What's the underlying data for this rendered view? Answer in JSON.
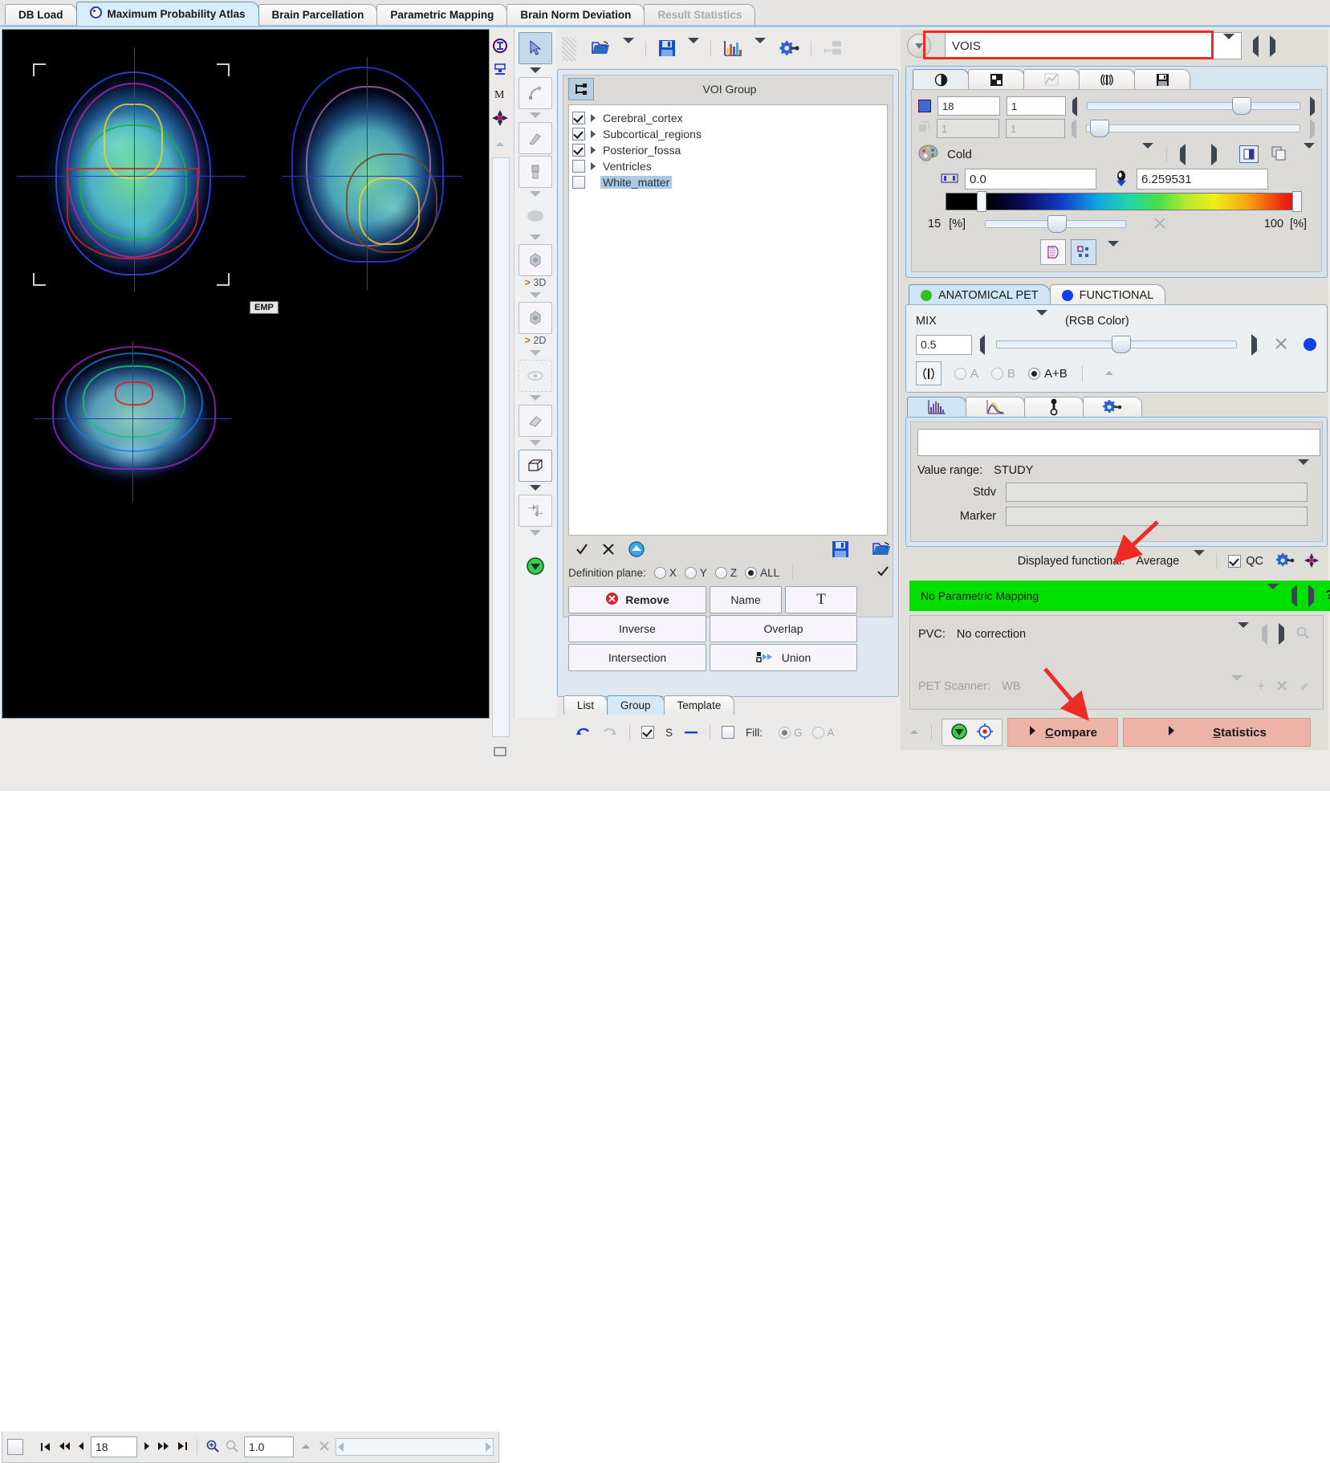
{
  "tabs": [
    {
      "label": "DB Load",
      "active": false,
      "disabled": false,
      "dot": false
    },
    {
      "label": "Maximum Probability Atlas",
      "active": true,
      "disabled": false,
      "dot": true
    },
    {
      "label": "Brain Parcellation",
      "active": false,
      "disabled": false,
      "dot": false
    },
    {
      "label": "Parametric Mapping",
      "active": false,
      "disabled": false,
      "dot": false
    },
    {
      "label": "Brain Norm Deviation",
      "active": false,
      "disabled": false,
      "dot": false
    },
    {
      "label": "Result Statistics",
      "active": false,
      "disabled": true,
      "dot": false
    }
  ],
  "image_viewer": {
    "overlay_label": "EMP",
    "slice_value": "18",
    "zoom_value": "1.0"
  },
  "voi_panel": {
    "header_title": "VOI Group",
    "items": [
      {
        "label": "Cerebral_cortex",
        "checked": true,
        "expandable": true,
        "selected": false
      },
      {
        "label": "Subcortical_regions",
        "checked": true,
        "expandable": true,
        "selected": false
      },
      {
        "label": "Posterior_fossa",
        "checked": true,
        "expandable": true,
        "selected": false
      },
      {
        "label": "Ventricles",
        "checked": false,
        "expandable": true,
        "selected": false
      },
      {
        "label": "White_matter",
        "checked": false,
        "expandable": false,
        "selected": true
      }
    ],
    "definition_plane_label": "Definition plane:",
    "plane_options": [
      {
        "label": "X",
        "selected": false
      },
      {
        "label": "Y",
        "selected": false
      },
      {
        "label": "Z",
        "selected": false
      },
      {
        "label": "ALL",
        "selected": true
      }
    ],
    "buttons": {
      "remove": "Remove",
      "name": "Name",
      "text": "T",
      "inverse": "Inverse",
      "overlap": "Overlap",
      "intersection": "Intersection",
      "union": "Union"
    },
    "tabs": [
      {
        "label": "List",
        "active": false
      },
      {
        "label": "Group",
        "active": true
      },
      {
        "label": "Template",
        "active": false
      }
    ],
    "footer": {
      "s_label": "S",
      "s_checked": true,
      "fill_label": "Fill:",
      "fill_checked": false,
      "fill_options": [
        {
          "label": "G",
          "selected": true
        },
        {
          "label": "A",
          "selected": false
        }
      ]
    }
  },
  "right_panel": {
    "vois_field_value": "VOIS",
    "display_tabs_icons": [
      "contrast-icon",
      "grid-icon",
      "curve-icon",
      "brain-icon",
      "save-icon"
    ],
    "slice_row": {
      "value": "18",
      "sub": "1"
    },
    "slice_row2": {
      "value": "1",
      "sub": "1"
    },
    "colortable": {
      "name": "Cold"
    },
    "range": {
      "min": "0.0",
      "max": "6.259531"
    },
    "threshold": {
      "low": "15",
      "low_unit": "[%]",
      "high": "100",
      "high_unit": "[%]"
    },
    "fusion_tabs": [
      {
        "label": "ANATOMICAL PET",
        "color": "#34c024",
        "active": true
      },
      {
        "label": "FUNCTIONAL",
        "color": "#1040e8",
        "active": false
      }
    ],
    "mix": {
      "mode": "MIX",
      "rgb_label": "(RGB Color)",
      "value": "0.5"
    },
    "ab_options": [
      {
        "label": "A",
        "selected": false,
        "disabled": true
      },
      {
        "label": "B",
        "selected": false,
        "disabled": true
      },
      {
        "label": "A+B",
        "selected": true,
        "disabled": false
      }
    ],
    "stat_tabs": [
      "histogram-icon",
      "curve-plot-icon",
      "probe-icon",
      "settings-icon"
    ],
    "stats": {
      "value_range_label": "Value range:",
      "value_range": "STUDY",
      "stdv_label": "Stdv",
      "stdv_value": "",
      "marker_label": "Marker",
      "marker_value": "",
      "text_field_value": ""
    },
    "displayed_functional": {
      "label": "Displayed functional:",
      "value": "Average",
      "qc_label": "QC",
      "qc_checked": true
    },
    "parametric_mapping": {
      "text": "No Parametric Mapping",
      "color": "#00e000"
    },
    "pvc": {
      "label": "PVC:",
      "value": "No correction"
    },
    "pet_scanner": {
      "label": "PET Scanner:",
      "value": "WB"
    },
    "action_buttons": [
      {
        "label": "Compare",
        "underline_first": true
      },
      {
        "label": "Statistics",
        "underline_first": true
      }
    ]
  },
  "colors": {
    "accent_red": "#ee2b24",
    "green_status": "#00e000",
    "pink_button": "#edb3a6",
    "tab_active": "#d9ecf9",
    "panel_blue": "#d6e4f0"
  }
}
